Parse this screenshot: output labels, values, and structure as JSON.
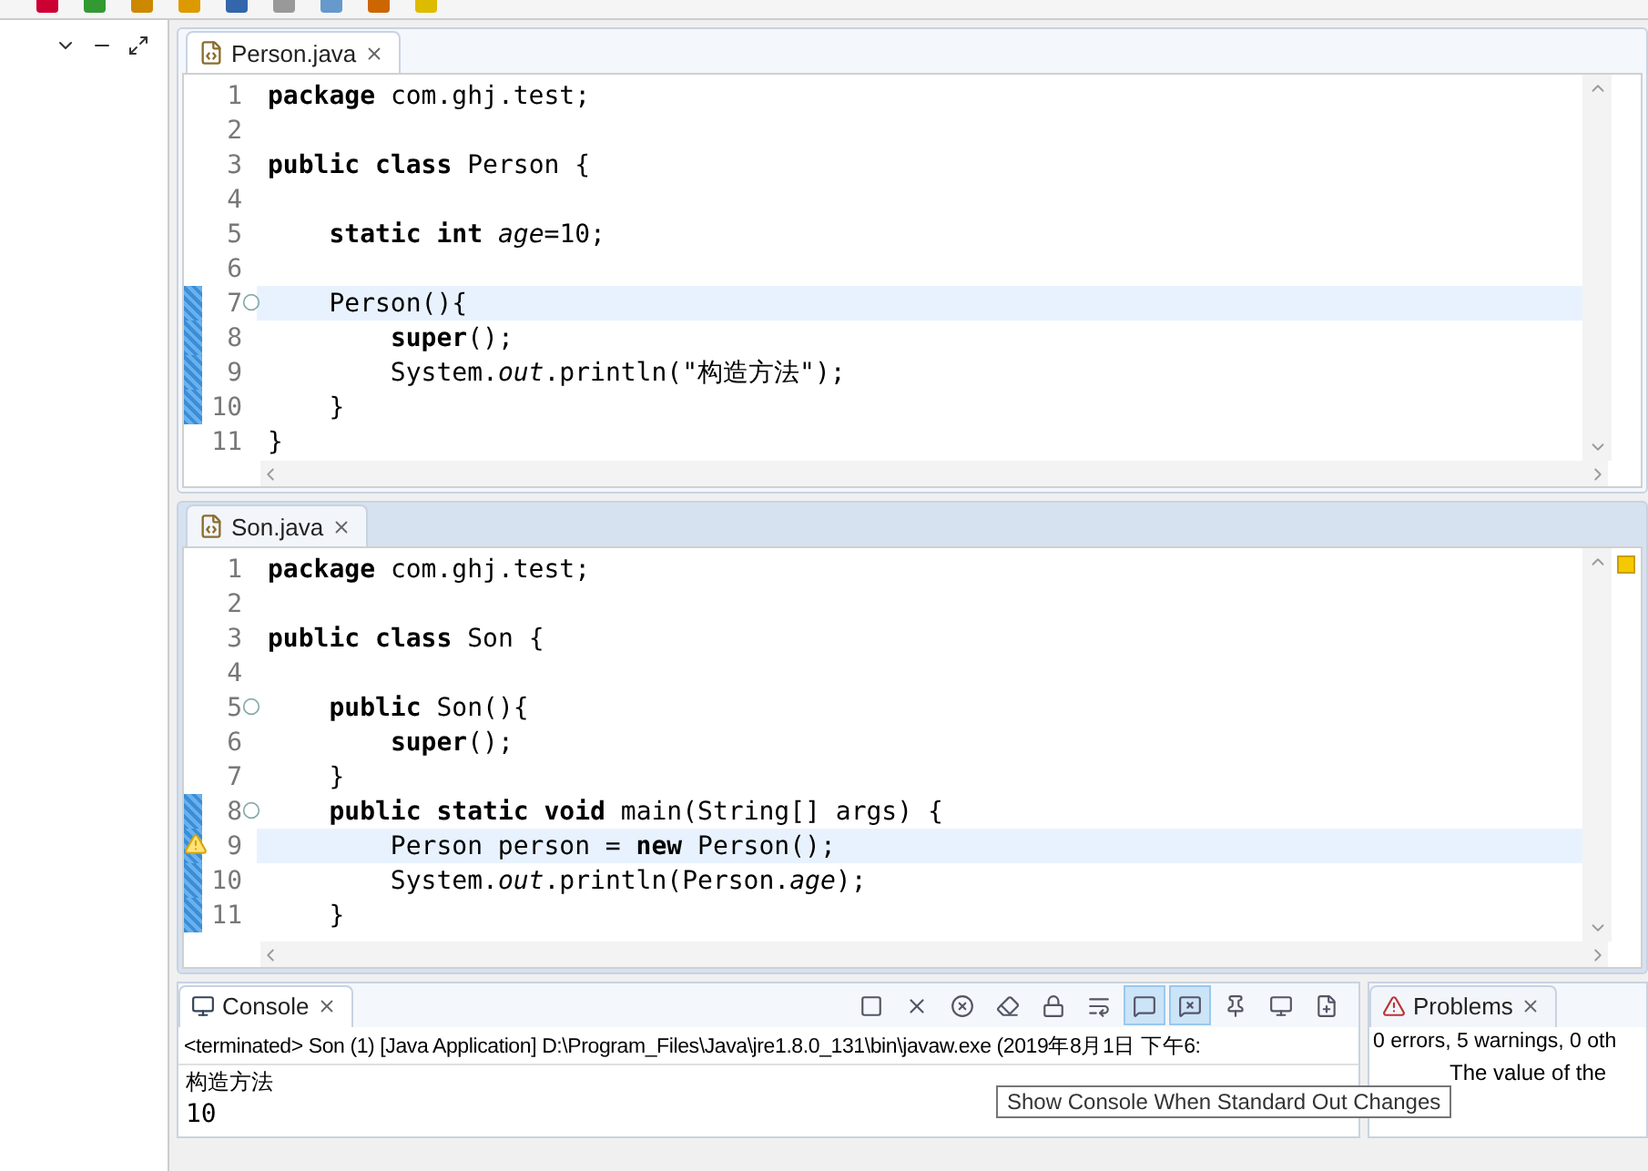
{
  "editors": [
    {
      "tab": {
        "label": "Person.java",
        "selected": true
      },
      "lines": [
        {
          "no": "1",
          "changed": false,
          "fold": false,
          "current": false,
          "code": "**package** com.ghj.test;"
        },
        {
          "no": "2",
          "changed": false,
          "fold": false,
          "current": false
        },
        {
          "no": "3",
          "changed": false,
          "fold": false,
          "current": false,
          "code": "**public** **class** Person {"
        },
        {
          "no": "4",
          "changed": false,
          "fold": false,
          "current": false
        },
        {
          "no": "5",
          "changed": false,
          "fold": false,
          "current": false,
          "code": "    **static** **int** *age*=10;"
        },
        {
          "no": "6",
          "changed": false,
          "fold": false,
          "current": false
        },
        {
          "no": "7",
          "changed": true,
          "fold": true,
          "current": true,
          "code": "    Person(){"
        },
        {
          "no": "8",
          "changed": true,
          "fold": false,
          "current": false,
          "code": "        **super**();"
        },
        {
          "no": "9",
          "changed": true,
          "fold": false,
          "current": false,
          "code": "        System.*out*.println(\"构造方法\");"
        },
        {
          "no": "10",
          "changed": true,
          "fold": false,
          "current": false,
          "code": "    }"
        },
        {
          "no": "11",
          "changed": false,
          "fold": false,
          "current": false,
          "code": "}"
        }
      ]
    },
    {
      "tab": {
        "label": "Son.java",
        "selected": false
      },
      "lines": [
        {
          "no": "1",
          "changed": false,
          "fold": false,
          "current": false,
          "code": "**package** com.ghj.test;"
        },
        {
          "no": "2",
          "changed": false,
          "fold": false,
          "current": false
        },
        {
          "no": "3",
          "changed": false,
          "fold": false,
          "current": false,
          "code": "**public** **class** Son {"
        },
        {
          "no": "4",
          "changed": false,
          "fold": false,
          "current": false
        },
        {
          "no": "5",
          "changed": false,
          "fold": true,
          "current": false,
          "code": "    **public** Son(){"
        },
        {
          "no": "6",
          "changed": false,
          "fold": false,
          "current": false,
          "code": "        **super**();"
        },
        {
          "no": "7",
          "changed": false,
          "fold": false,
          "current": false,
          "code": "    }"
        },
        {
          "no": "8",
          "changed": true,
          "fold": true,
          "current": false,
          "code": "    **public** **static** **void** main(String[] args) {"
        },
        {
          "no": "9",
          "changed": true,
          "fold": false,
          "current": true,
          "warning": true,
          "code": "        Person person = **new** Person();"
        },
        {
          "no": "10",
          "changed": true,
          "fold": false,
          "current": false,
          "code": "        System.*out*.println(Person.*age*);"
        },
        {
          "no": "11",
          "changed": true,
          "fold": false,
          "current": false,
          "code": "    }"
        }
      ]
    }
  ],
  "console": {
    "tab": {
      "label": "Console",
      "selected": true
    },
    "tools": [
      {
        "kind": "stop",
        "pressed": false
      },
      {
        "kind": "remove",
        "pressed": false
      },
      {
        "kind": "remove-all",
        "pressed": false
      },
      {
        "kind": "clear",
        "pressed": false
      },
      {
        "kind": "lock",
        "pressed": false
      },
      {
        "kind": "wrap",
        "pressed": false
      },
      {
        "kind": "show-out",
        "pressed": true
      },
      {
        "kind": "show-err",
        "pressed": true
      },
      {
        "kind": "pin",
        "pressed": false
      },
      {
        "kind": "display",
        "pressed": false
      },
      {
        "kind": "new",
        "pressed": false
      }
    ],
    "status": "<terminated> Son (1) [Java Application] D:\\Program_Files\\Java\\jre1.8.0_131\\bin\\javaw.exe (2019年8月1日 下午6:",
    "output": [
      "构造方法",
      "10"
    ],
    "tooltip": "Show Console When Standard Out Changes"
  },
  "problems": {
    "tab": {
      "label": "Problems",
      "selected": false
    },
    "summary": "0 errors, 5 warnings, 0 oth",
    "items": [
      "The value of the"
    ]
  }
}
